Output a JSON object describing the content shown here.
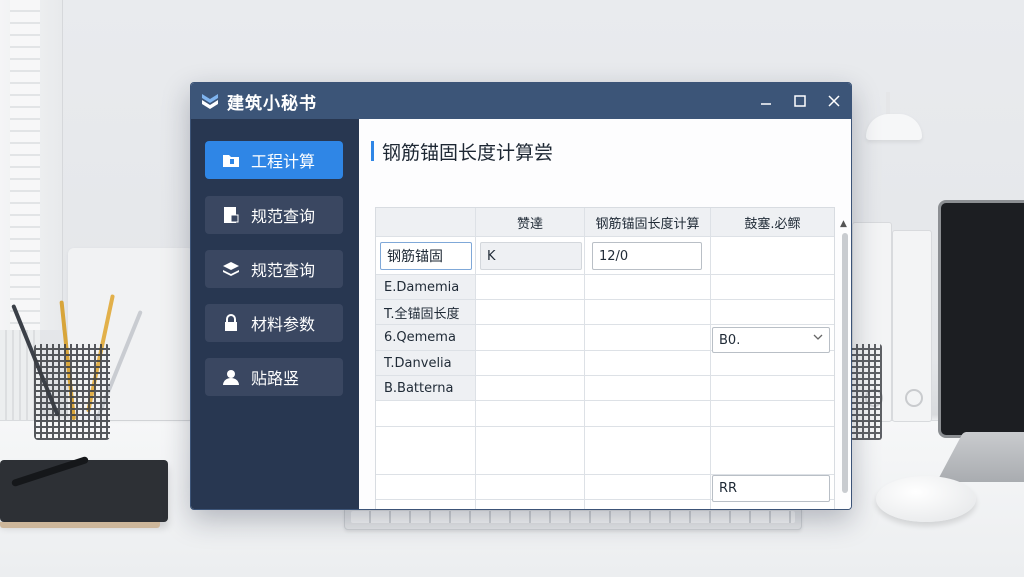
{
  "app": {
    "title": "建筑小秘书",
    "controls": [
      "minimize",
      "maximize",
      "close"
    ]
  },
  "sidebar": {
    "items": [
      {
        "label": "工程计算",
        "icon": "folder-icon",
        "active": true
      },
      {
        "label": "规范查询",
        "icon": "document-icon",
        "active": false
      },
      {
        "label": "规范查询",
        "icon": "stack-icon",
        "active": false
      },
      {
        "label": "材料参数",
        "icon": "lock-icon",
        "active": false
      },
      {
        "label": "贴路竖",
        "icon": "user-icon",
        "active": false
      }
    ]
  },
  "main": {
    "title": "钢筋锚固长度计算尝",
    "columns": [
      "",
      "赞達",
      "钢筋锚固长度计算",
      "鼓塞.必鳏"
    ],
    "input_row": {
      "label": "钢筋锚固",
      "value1": "K",
      "value2": "12/0"
    },
    "rows": [
      "E.Damemia",
      "T.全锚固长度",
      "6.Qemema",
      "T.Danvelia",
      "B.Batterna"
    ],
    "select_value": "B0.",
    "result_value": "RR"
  },
  "colors": {
    "titlebar": "#3c5578",
    "sidebar": "#283751",
    "active_nav": "#2f86e6"
  }
}
